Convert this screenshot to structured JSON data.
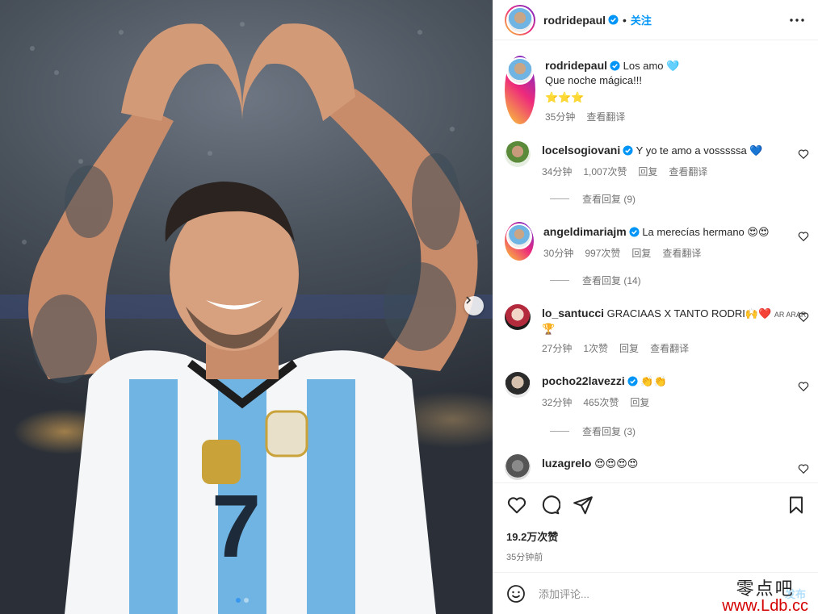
{
  "post": {
    "author": "rodridepaul",
    "follow_label": "关注",
    "caption_lines": [
      "Los amo 🩵",
      "Que noche mágica!!!",
      "⭐⭐⭐"
    ],
    "caption_time": "35分钟",
    "translate_label": "查看翻译",
    "likes": "19.2万次赞",
    "posted_ago": "35分钟前",
    "add_comment_placeholder": "添加评论...",
    "post_label": "发布"
  },
  "comments": [
    {
      "user": "locelsogiovani",
      "verified": true,
      "text": "Y yo te amo a vosssssa 💙",
      "time": "34分钟",
      "likes": "1,007次赞",
      "reply": "回复",
      "translate": "查看翻译",
      "replies": "查看回复 (9)"
    },
    {
      "user": "angeldimariajm",
      "verified": true,
      "text": "La merecías hermano 😍😍",
      "time": "30分钟",
      "likes": "997次赞",
      "reply": "回复",
      "translate": "查看翻译",
      "replies": "查看回复 (14)"
    },
    {
      "user": "lo_santucci",
      "verified": false,
      "text": "GRACIAAS X TANTO RODRI🙌❤️",
      "text2": "🏆",
      "small_tag": "AR ARAR",
      "time": "27分钟",
      "likes": "1次赞",
      "reply": "回复",
      "translate": "查看翻译"
    },
    {
      "user": "pocho22lavezzi",
      "verified": true,
      "text": "👏👏",
      "time": "32分钟",
      "likes": "465次赞",
      "reply": "回复",
      "replies": "查看回复 (3)"
    },
    {
      "user": "luzagrelo",
      "verified": false,
      "text": "😍😍😍😍"
    }
  ],
  "watermark": {
    "line1": "零点吧",
    "line2": "www.Ldb.cc"
  },
  "icons": [
    "more-icon",
    "heart-icon",
    "comment-icon",
    "share-icon",
    "bookmark-icon",
    "emoji-icon",
    "chevron-right-icon",
    "verified-icon"
  ]
}
